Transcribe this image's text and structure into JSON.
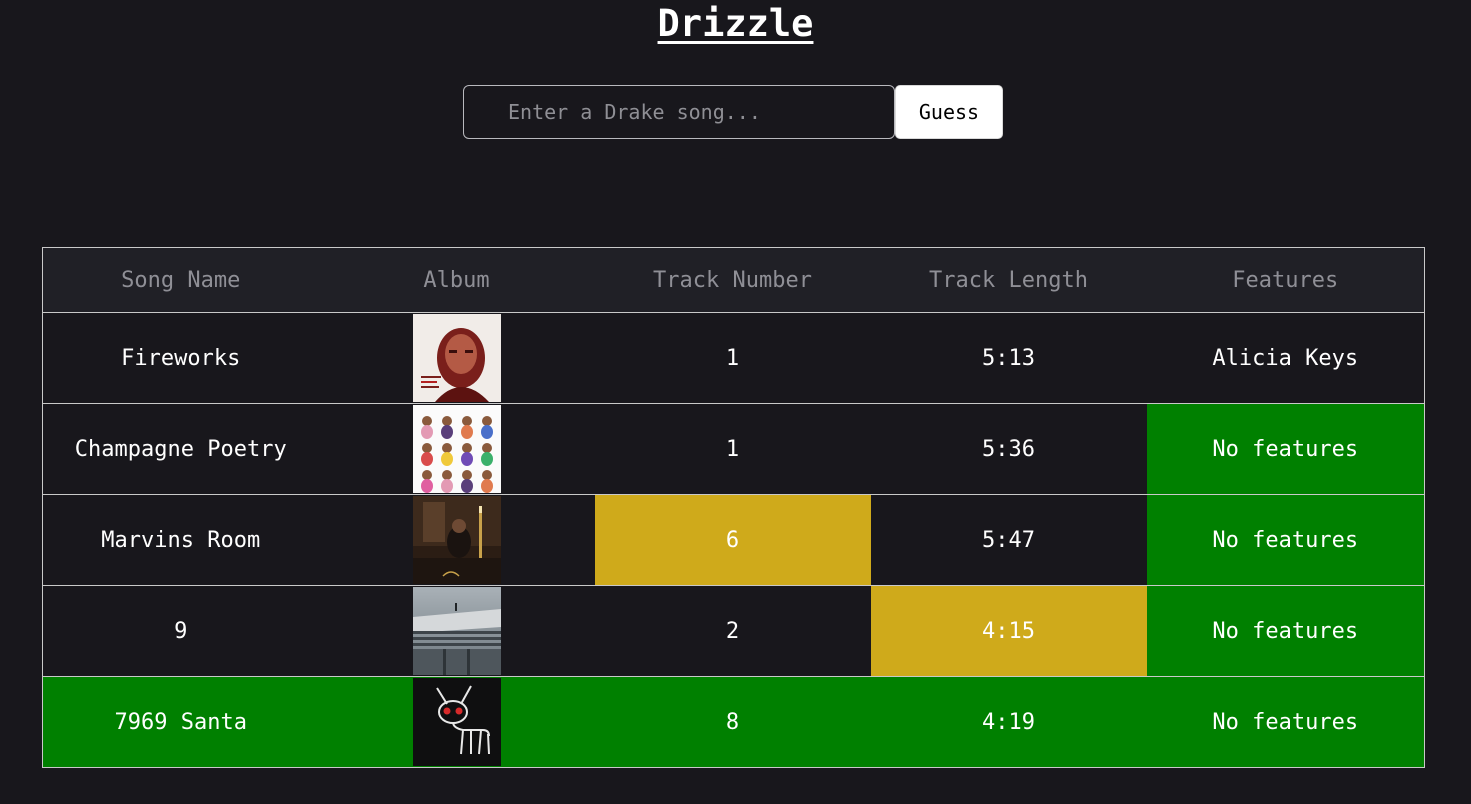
{
  "header": {
    "title": "Drizzle"
  },
  "search": {
    "placeholder": "Enter a Drake song...",
    "value": ""
  },
  "guess_button": {
    "label": "Guess"
  },
  "table": {
    "columns": [
      "Song Name",
      "Album",
      "Track Number",
      "Track Length",
      "Features"
    ],
    "rows": [
      {
        "song": "Fireworks",
        "album_cover": "thank-me-later-cover",
        "track_number": "1",
        "track_length": "5:13",
        "features": "Alicia Keys",
        "status": {
          "song": "none",
          "album": "none",
          "track_number": "none",
          "track_length": "none",
          "features": "none"
        }
      },
      {
        "song": "Champagne Poetry",
        "album_cover": "certified-lover-boy-cover",
        "track_number": "1",
        "track_length": "5:36",
        "features": "No features",
        "status": {
          "song": "none",
          "album": "none",
          "track_number": "none",
          "track_length": "none",
          "features": "green"
        }
      },
      {
        "song": "Marvins Room",
        "album_cover": "take-care-cover",
        "track_number": "6",
        "track_length": "5:47",
        "features": "No features",
        "status": {
          "song": "none",
          "album": "none",
          "track_number": "yellow",
          "track_length": "none",
          "features": "green"
        }
      },
      {
        "song": "9",
        "album_cover": "views-cover",
        "track_number": "2",
        "track_length": "4:15",
        "features": "No features",
        "status": {
          "song": "none",
          "album": "none",
          "track_number": "none",
          "track_length": "yellow",
          "features": "green"
        }
      },
      {
        "song": "7969 Santa",
        "album_cover": "for-all-the-dogs-cover",
        "track_number": "8",
        "track_length": "4:19",
        "features": "No features",
        "status": {
          "song": "green",
          "album": "green",
          "track_number": "green",
          "track_length": "green",
          "features": "green"
        }
      }
    ]
  },
  "colors": {
    "background": "#18171c",
    "correct": "#008000",
    "close": "#cfaa1b",
    "header_row": "#202026"
  }
}
